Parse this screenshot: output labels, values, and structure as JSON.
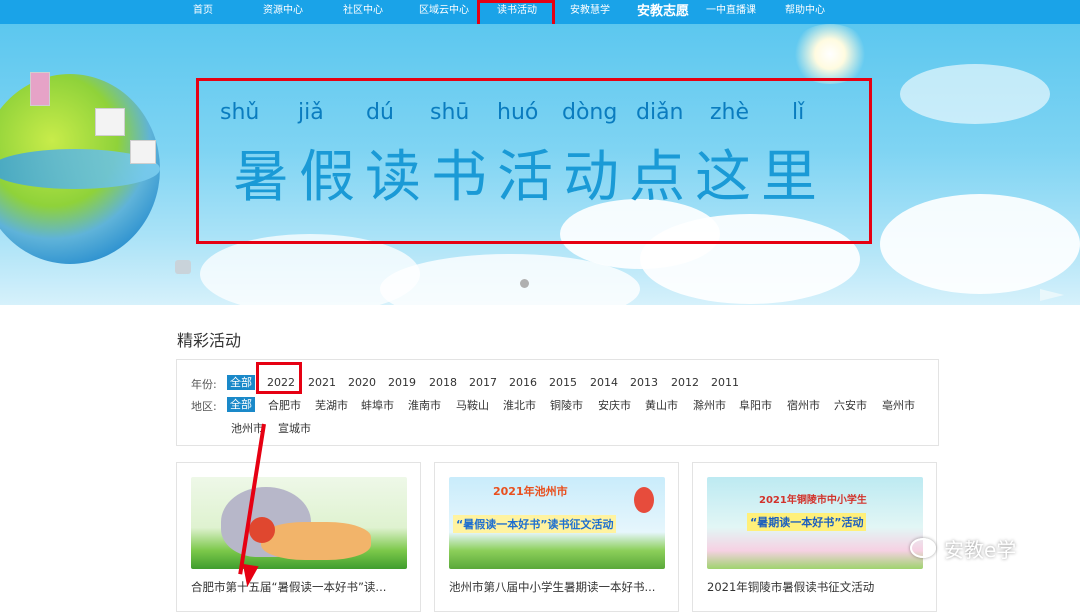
{
  "nav": {
    "items": [
      "首页",
      "资源中心",
      "社区中心",
      "区域云中心",
      "读书活动",
      "安教慧学",
      "安教志愿",
      "一中直播课",
      "帮助中心"
    ],
    "active": "读书活动"
  },
  "banner": {
    "pinyin": [
      "shǔ",
      "jiǎ",
      "dú",
      "shū",
      "huó",
      "dòng",
      "diǎn",
      "zhè",
      "lǐ"
    ],
    "title": "暑假读书活动点这里"
  },
  "section": {
    "title": "精彩活动"
  },
  "filters": {
    "year_label": "年份:",
    "years": [
      "全部",
      "2022",
      "2021",
      "2020",
      "2019",
      "2018",
      "2017",
      "2016",
      "2015",
      "2014",
      "2013",
      "2012",
      "2011"
    ],
    "year_selected": "全部",
    "region_label": "地区:",
    "regions": [
      "全部",
      "合肥市",
      "芜湖市",
      "蚌埠市",
      "淮南市",
      "马鞍山",
      "淮北市",
      "铜陵市",
      "安庆市",
      "黄山市",
      "滁州市",
      "阜阳市",
      "宿州市",
      "六安市",
      "亳州市",
      "池州市",
      "宣城市"
    ],
    "region_selected": "全部"
  },
  "cards": [
    {
      "title": "合肥市第十五届“暑假读一本好书”读...",
      "poster_lines": []
    },
    {
      "title": "池州市第八届中小学生暑期读一本好书...",
      "poster_lines": [
        "2021年池州市",
        "“暑假读一本好书”读书征文活动"
      ]
    },
    {
      "title": "2021年铜陵市暑假读书征文活动",
      "poster_lines": [
        "2021年铜陵市中小学生",
        "“暑期读一本好书”活动"
      ]
    }
  ],
  "watermark": "安教e学",
  "colors": {
    "nav_bg": "#1aa3e8",
    "accent": "#1a89c9",
    "highlight": "#e60012",
    "title_blue": "#1a9ad6"
  }
}
